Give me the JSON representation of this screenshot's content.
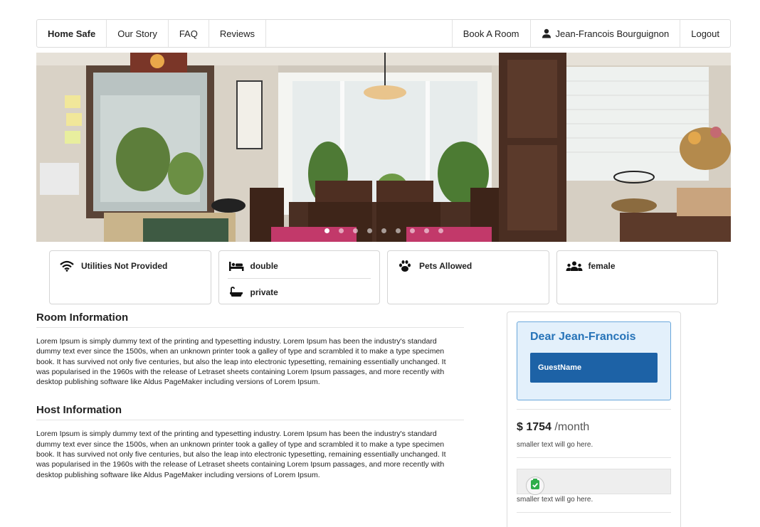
{
  "nav": {
    "brand": "Home Safe",
    "left_items": [
      "Our Story",
      "FAQ",
      "Reviews"
    ],
    "book": "Book A Room",
    "user": "Jean-Francois Bourguignon",
    "logout": "Logout"
  },
  "hero": {
    "dots": 9,
    "active_dot": 0
  },
  "features": {
    "utilities": "Utilities Not Provided",
    "bed": "double",
    "bath": "private",
    "pets": "Pets Allowed",
    "gender": "female"
  },
  "room": {
    "title": "Room Information",
    "body": "Lorem Ipsum is simply dummy text of the printing and typesetting industry. Lorem Ipsum has been the industry's standard dummy text ever since the 1500s, when an unknown printer took a galley of type and scrambled it to make a type specimen book. It has survived not only five centuries, but also the leap into electronic typesetting, remaining essentially unchanged. It was popularised in the 1960s with the release of Letraset sheets containing Lorem Ipsum passages, and more recently with desktop publishing software like Aldus PageMaker including versions of Lorem Ipsum."
  },
  "host": {
    "title": "Host Information",
    "body": "Lorem Ipsum is simply dummy text of the printing and typesetting industry. Lorem Ipsum has been the industry's standard dummy text ever since the 1500s, when an unknown printer took a galley of type and scrambled it to make a type specimen book. It has survived not only five centuries, but also the leap into electronic typesetting, remaining essentially unchanged. It was popularised in the 1960s with the release of Letraset sheets containing Lorem Ipsum passages, and more recently with desktop publishing software like Aldus PageMaker including versions of Lorem Ipsum."
  },
  "sidebar": {
    "greeting": "Dear Jean-Francois",
    "guest_button": "GuestName",
    "price_amount": "$ 1754",
    "price_period": "/month",
    "small_text_1": "smaller text will go here.",
    "small_text_2": "smaller text will go here."
  },
  "colors": {
    "accent": "#2673b8",
    "button": "#1d62a6",
    "greeting_bg": "#e3f0fb",
    "check_green": "#2fae4a"
  },
  "icons": {
    "user": "user-icon",
    "wifi": "wifi-icon",
    "bed": "bed-icon",
    "bath": "bathtub-icon",
    "pets": "paw-icon",
    "gender": "users-icon",
    "check": "shield-check-icon"
  }
}
